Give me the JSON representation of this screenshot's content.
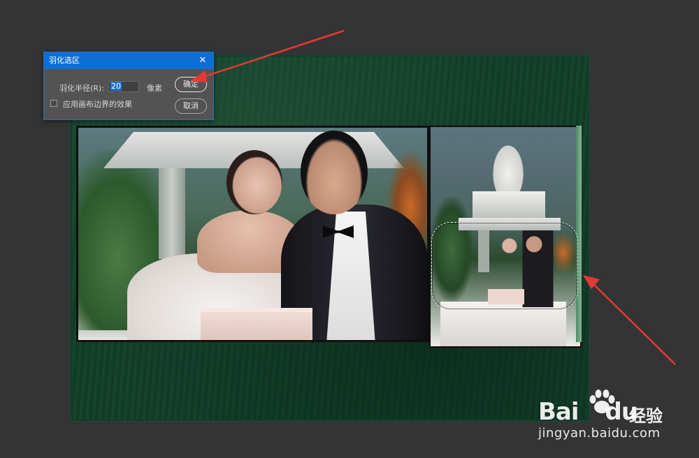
{
  "dialog": {
    "title": "羽化选区",
    "radius_label": "羽化半径(R):",
    "radius_value": "20",
    "unit": "像素",
    "ok_label": "确定",
    "cancel_label": "取消",
    "checkbox_label": "应用画布边界的效果",
    "checkbox_checked": false,
    "close_glyph": "✕"
  },
  "watermark": {
    "brand_left": "Bai",
    "brand_right": "du",
    "brand_cn": "经验",
    "url": "jingyan.baidu.com"
  },
  "colors": {
    "workspace": "#343434",
    "canvas_green": "#123f2a",
    "dialog_titlebar": "#0d6fd6",
    "annotation_red": "#e53935"
  },
  "icons": {
    "close": "close-icon",
    "checkbox": "checkbox-icon",
    "paw": "baidu-paw-icon"
  }
}
